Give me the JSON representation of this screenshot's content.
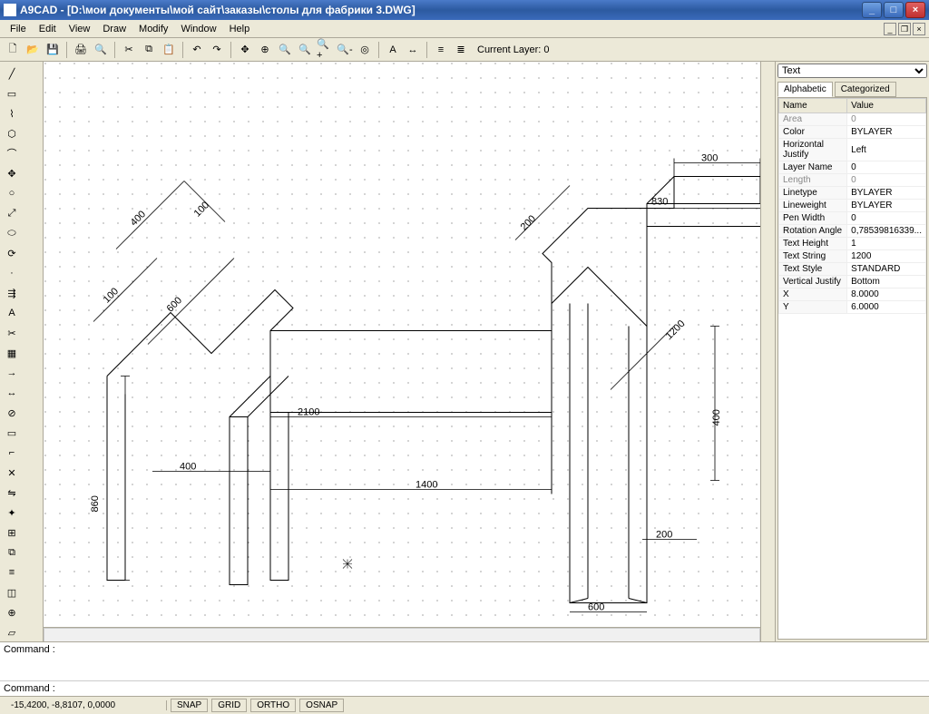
{
  "title": "A9CAD - [D:\\мои документы\\мой сайт\\заказы\\столы для фабрики 3.DWG]",
  "menu": [
    "File",
    "Edit",
    "View",
    "Draw",
    "Modify",
    "Window",
    "Help"
  ],
  "layer_label": "Current Layer: 0",
  "prop_selector": "Text",
  "tabs": {
    "alpha": "Alphabetic",
    "cat": "Categorized"
  },
  "prop_headers": {
    "name": "Name",
    "value": "Value"
  },
  "props": [
    {
      "n": "Area",
      "v": "0",
      "ro": true
    },
    {
      "n": "Color",
      "v": "BYLAYER"
    },
    {
      "n": "Horizontal Justify",
      "v": "Left"
    },
    {
      "n": "Layer Name",
      "v": "0"
    },
    {
      "n": "Length",
      "v": "0",
      "ro": true
    },
    {
      "n": "Linetype",
      "v": "BYLAYER"
    },
    {
      "n": "Lineweight",
      "v": "BYLAYER"
    },
    {
      "n": "Pen Width",
      "v": "0"
    },
    {
      "n": "Rotation Angle",
      "v": "0,78539816339..."
    },
    {
      "n": "Text Height",
      "v": "1"
    },
    {
      "n": "Text String",
      "v": "1200"
    },
    {
      "n": "Text Style",
      "v": "STANDARD"
    },
    {
      "n": "Vertical Justify",
      "v": "Bottom"
    },
    {
      "n": "X",
      "v": "8.0000"
    },
    {
      "n": "Y",
      "v": "6.0000"
    }
  ],
  "cmd_label": "Command :",
  "status": {
    "coords": "-15,4200, -8,8107, 0,0000"
  },
  "snaps": [
    "SNAP",
    "GRID",
    "ORTHO",
    "OSNAP"
  ],
  "dims": {
    "d300": "300",
    "d830": "830",
    "d400a": "400",
    "d100a": "100",
    "d100b": "100",
    "d600a": "600",
    "d200a": "200",
    "d1200": "1200",
    "d2100": "2100",
    "d400b": "400",
    "d400c": "400",
    "d1400": "1400",
    "d860": "860",
    "d200b": "200",
    "d600b": "600"
  }
}
